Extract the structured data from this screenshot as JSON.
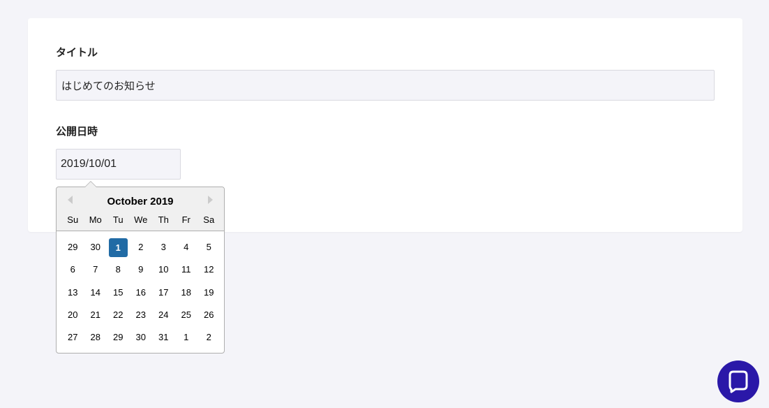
{
  "form": {
    "title_label": "タイトル",
    "title_value": "はじめてのお知らせ",
    "date_label": "公開日時",
    "date_value": "2019/10/01"
  },
  "datepicker": {
    "month_label": "October 2019",
    "weekdays": [
      "Su",
      "Mo",
      "Tu",
      "We",
      "Th",
      "Fr",
      "Sa"
    ],
    "weeks": [
      [
        "29",
        "30",
        "1",
        "2",
        "3",
        "4",
        "5"
      ],
      [
        "6",
        "7",
        "8",
        "9",
        "10",
        "11",
        "12"
      ],
      [
        "13",
        "14",
        "15",
        "16",
        "17",
        "18",
        "19"
      ],
      [
        "20",
        "21",
        "22",
        "23",
        "24",
        "25",
        "26"
      ],
      [
        "27",
        "28",
        "29",
        "30",
        "31",
        "1",
        "2"
      ]
    ],
    "selected": {
      "week": 0,
      "day": 2
    },
    "selected_color": "#216ba5"
  },
  "chat": {
    "icon": "chat-bubble-icon",
    "color": "#2a18a8"
  }
}
